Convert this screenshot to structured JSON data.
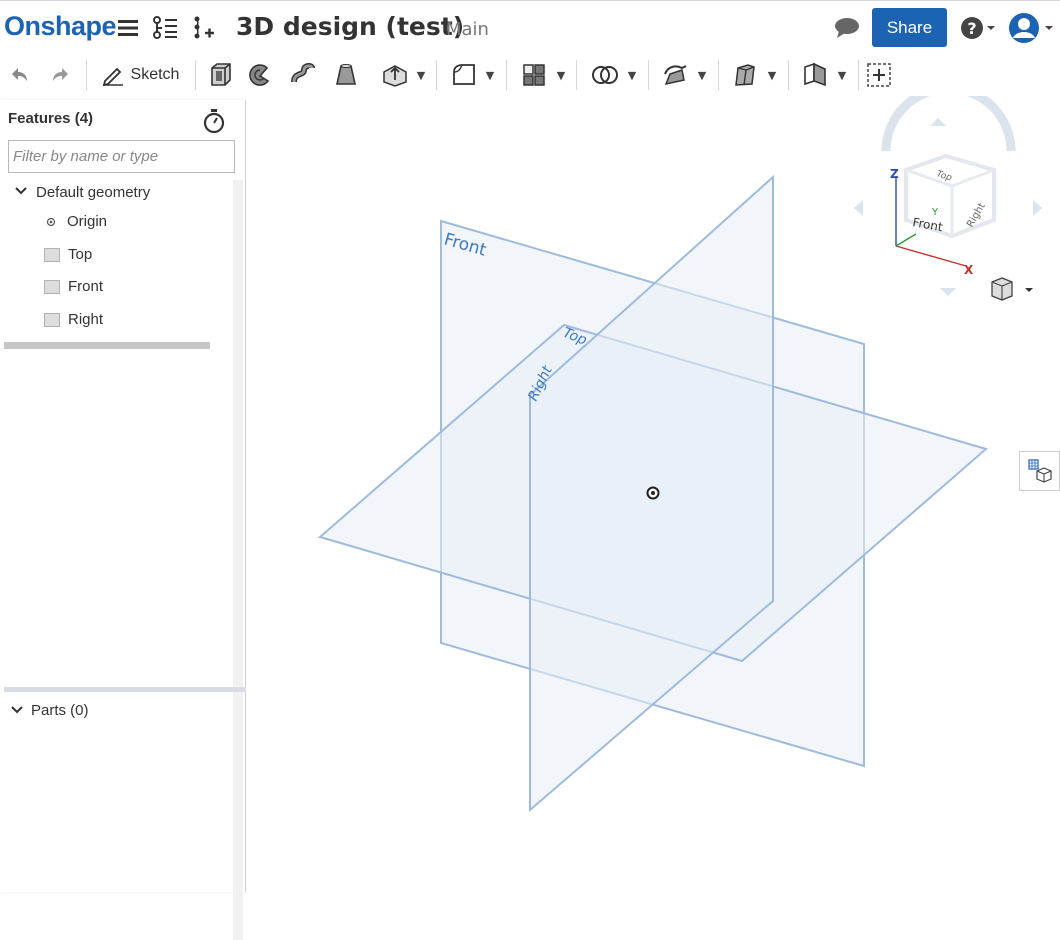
{
  "header": {
    "logo": "Onshape",
    "document_title": "3D design (test)",
    "branch": "Main",
    "share_label": "Share"
  },
  "toolbar": {
    "sketch_label": "Sketch"
  },
  "feature_panel": {
    "title": "Features (4)",
    "filter_placeholder": "Filter by name or type",
    "group_label": "Default geometry",
    "items": [
      {
        "label": "Origin",
        "icon": "origin-icon"
      },
      {
        "label": "Top",
        "icon": "plane-icon"
      },
      {
        "label": "Front",
        "icon": "plane-icon"
      },
      {
        "label": "Right",
        "icon": "plane-icon"
      }
    ],
    "parts_label": "Parts (0)"
  },
  "viewport": {
    "plane_labels": {
      "front": "Front",
      "top": "Top",
      "right": "Right"
    },
    "view_cube": {
      "top": "Top",
      "front": "Front",
      "right": "Right",
      "axis_x": "X",
      "axis_y": "Y",
      "axis_z": "Z"
    }
  },
  "colors": {
    "brand": "#1d63b4",
    "plane_fill": "#e8eef5",
    "plane_edge": "#9fbbdc",
    "plane_label": "#3d78c4"
  }
}
